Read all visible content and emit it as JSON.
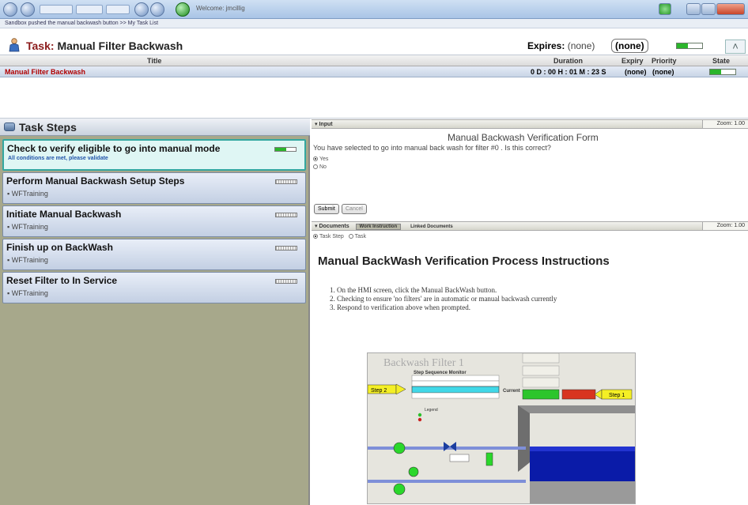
{
  "browser": {
    "title": "Welcome: jmcillig",
    "breadcrumb": "Sandbox pushed the manual backwash button >> My Task List"
  },
  "task": {
    "label": "Task:",
    "name": "Manual Filter Backwash",
    "expires_label": "Expires:",
    "expires_value": "(none)",
    "expires_badge": "(none)",
    "collapse_icon": "double-chevron-up-icon"
  },
  "table": {
    "headers": {
      "title": "Title",
      "duration": "Duration",
      "expiry": "Expiry",
      "priority": "Priority",
      "state": "State"
    },
    "row": {
      "title": "Manual Filter Backwash",
      "duration": "0 D : 00 H : 01 M : 23 S",
      "expiry": "(none)",
      "priority": "(none)",
      "state_progress": 0.45
    }
  },
  "steps": {
    "header": "Task Steps",
    "items": [
      {
        "title": "Check to verify eligible to go into manual mode",
        "sub": "All conditions are met, please validate",
        "active": true,
        "progress": 0.55
      },
      {
        "title": "Perform Manual Backwash Setup Steps",
        "sub": "WFTraining",
        "active": false
      },
      {
        "title": "Initiate Manual Backwash",
        "sub": "WFTraining",
        "active": false
      },
      {
        "title": "Finish up on BackWash",
        "sub": "WFTraining",
        "active": false
      },
      {
        "title": "Reset Filter to In Service",
        "sub": "WFTraining",
        "active": false
      }
    ]
  },
  "input": {
    "section": "Input",
    "zoom": "Zoom: 1.00",
    "form_title": "Manual Backwash Verification Form",
    "question": "You have selected to go into manual back wash for filter #0 . Is this correct?",
    "options": [
      "Yes",
      "No"
    ],
    "selected": "Yes",
    "submit": "Submit",
    "cancel": "Cancel"
  },
  "documents": {
    "section": "Documents",
    "tabs": [
      "Work Instruction",
      "Linked Documents"
    ],
    "zoom": "Zoom: 1.00",
    "view_options": [
      "Task Step",
      "Task"
    ],
    "title": "Manual BackWash Verification Process Instructions",
    "steps": [
      "On the HMI screen, click the Manual BackWash button.",
      "Checking to ensure 'no filters' are in automatic or manual backwash currently",
      "Respond to verification above when prompted."
    ],
    "figure": {
      "title": "Backwash Filter 1",
      "seq_title": "Step Sequence Monitor",
      "current": "Current",
      "legend": "Legend",
      "callout_left": "Step 2",
      "callout_right": "Step 1"
    }
  }
}
